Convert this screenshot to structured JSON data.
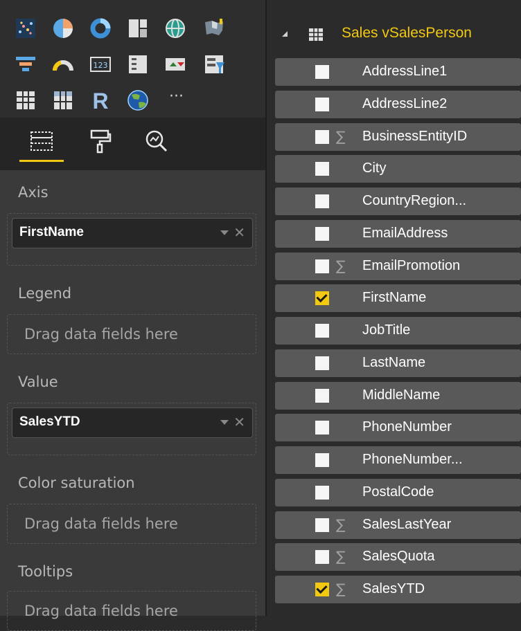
{
  "visualizations": {
    "icons": [
      "scatter-chart-icon",
      "pie-chart-icon",
      "donut-chart-icon",
      "treemap-icon",
      "globe-map-icon",
      "filled-map-icon",
      "funnel-icon",
      "gauge-icon",
      "card-icon",
      "multi-row-card-icon",
      "kpi-icon",
      "slicer-icon",
      "table-icon",
      "matrix-icon",
      "r-visual-icon",
      "arcgis-map-icon",
      "more-visuals-icon"
    ],
    "r_label": "R",
    "more_label": "···"
  },
  "pane_tabs": [
    {
      "name": "fields-tab",
      "active": true
    },
    {
      "name": "format-tab",
      "active": false
    },
    {
      "name": "analytics-tab",
      "active": false
    }
  ],
  "wells": {
    "axis": {
      "label": "Axis",
      "field": "FirstName"
    },
    "legend": {
      "label": "Legend",
      "placeholder": "Drag data fields here"
    },
    "value": {
      "label": "Value",
      "field": "SalesYTD"
    },
    "color_saturation": {
      "label": "Color saturation",
      "placeholder": "Drag data fields here"
    },
    "tooltips": {
      "label": "Tooltips",
      "placeholder": "Drag data fields here"
    }
  },
  "field_list": {
    "table_name": "Sales vSalesPerson",
    "sigma": "∑",
    "fields": [
      {
        "name": "AddressLine1",
        "checked": false,
        "sigma": false
      },
      {
        "name": "AddressLine2",
        "checked": false,
        "sigma": false
      },
      {
        "name": "BusinessEntityID",
        "checked": false,
        "sigma": true
      },
      {
        "name": "City",
        "checked": false,
        "sigma": false
      },
      {
        "name": "CountryRegion...",
        "checked": false,
        "sigma": false
      },
      {
        "name": "EmailAddress",
        "checked": false,
        "sigma": false
      },
      {
        "name": "EmailPromotion",
        "checked": false,
        "sigma": true
      },
      {
        "name": "FirstName",
        "checked": true,
        "sigma": false
      },
      {
        "name": "JobTitle",
        "checked": false,
        "sigma": false
      },
      {
        "name": "LastName",
        "checked": false,
        "sigma": false
      },
      {
        "name": "MiddleName",
        "checked": false,
        "sigma": false
      },
      {
        "name": "PhoneNumber",
        "checked": false,
        "sigma": false
      },
      {
        "name": "PhoneNumber...",
        "checked": false,
        "sigma": false
      },
      {
        "name": "PostalCode",
        "checked": false,
        "sigma": false
      },
      {
        "name": "SalesLastYear",
        "checked": false,
        "sigma": true
      },
      {
        "name": "SalesQuota",
        "checked": false,
        "sigma": true
      },
      {
        "name": "SalesYTD",
        "checked": true,
        "sigma": true
      }
    ]
  },
  "colors": {
    "accent": "#f2c811",
    "panel": "#3a3a3a",
    "row": "#595959"
  }
}
